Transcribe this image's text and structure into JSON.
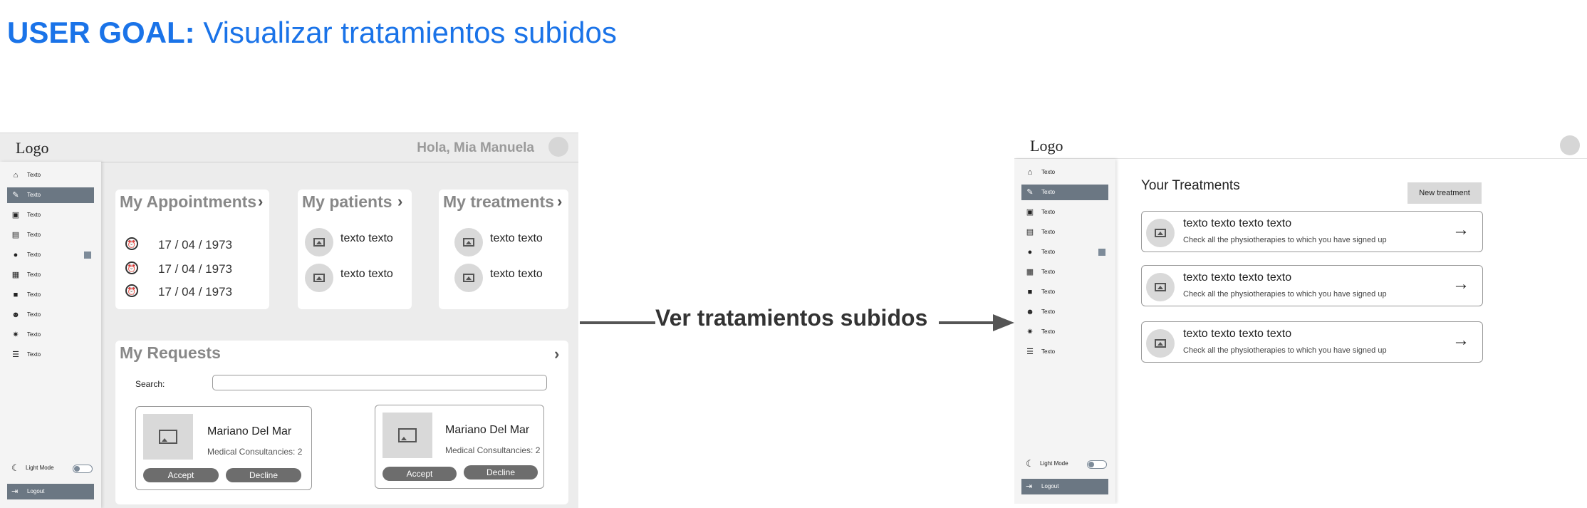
{
  "goal": {
    "prefix": "USER GOAL:",
    "text": "Visualizar tratamientos subidos"
  },
  "connector": {
    "label": "Ver tratamientos subidos"
  },
  "nav": {
    "logo": "Logo",
    "items": [
      {
        "icon": "home-icon",
        "glyph": "⌂",
        "label": "Texto"
      },
      {
        "icon": "edit-icon",
        "glyph": "✎",
        "label": "Texto"
      },
      {
        "icon": "image-icon",
        "glyph": "▣",
        "label": "Texto"
      },
      {
        "icon": "document-icon",
        "glyph": "▤",
        "label": "Texto"
      },
      {
        "icon": "chat-icon",
        "glyph": "●",
        "label": "Texto"
      },
      {
        "icon": "grid-icon",
        "glyph": "▦",
        "label": "Texto"
      },
      {
        "icon": "bag-icon",
        "glyph": "■",
        "label": "Texto"
      },
      {
        "icon": "people-icon",
        "glyph": "☻",
        "label": "Texto"
      },
      {
        "icon": "gear-icon",
        "glyph": "✷",
        "label": "Texto"
      },
      {
        "icon": "sliders-icon",
        "glyph": "☰",
        "label": "Texto"
      }
    ],
    "mode_label": "Light Mode",
    "mode_glyph": "☾",
    "logout_label": "Logout",
    "logout_glyph": "⇥"
  },
  "screen1": {
    "greeting": "Hola, Mia Manuela",
    "appointments": {
      "title": "My Appointments",
      "rows": [
        "17 / 04 / 1973",
        "17 / 04 / 1973",
        "17 / 04 / 1973"
      ]
    },
    "patients": {
      "title": "My patients",
      "rows": [
        "texto texto",
        "texto texto"
      ]
    },
    "treatments": {
      "title": "My treatments",
      "rows": [
        "texto texto",
        "texto texto"
      ]
    },
    "requests": {
      "title": "My Requests",
      "search_label": "Search:",
      "items": [
        {
          "name": "Mariano Del Mar",
          "detail": "Medical Consultancies: 2",
          "accept": "Accept",
          "decline": "Decline"
        },
        {
          "name": "Mariano Del Mar",
          "detail": "Medical Consultancies: 2",
          "accept": "Accept",
          "decline": "Decline"
        }
      ]
    }
  },
  "screen2": {
    "title": "Your Treatments",
    "new_button": "New treatment",
    "treatments": [
      {
        "title": "texto texto texto texto",
        "desc": "Check all the physiotherapies to which you have signed up"
      },
      {
        "title": "texto texto texto texto",
        "desc": "Check all the physiotherapies to which you have signed up"
      },
      {
        "title": "texto texto texto texto",
        "desc": "Check all the physiotherapies to which you have signed up"
      }
    ]
  },
  "colors": {
    "accent": "#1a73e8",
    "nav_active": "#6b7783",
    "button": "#6d6d6d"
  }
}
